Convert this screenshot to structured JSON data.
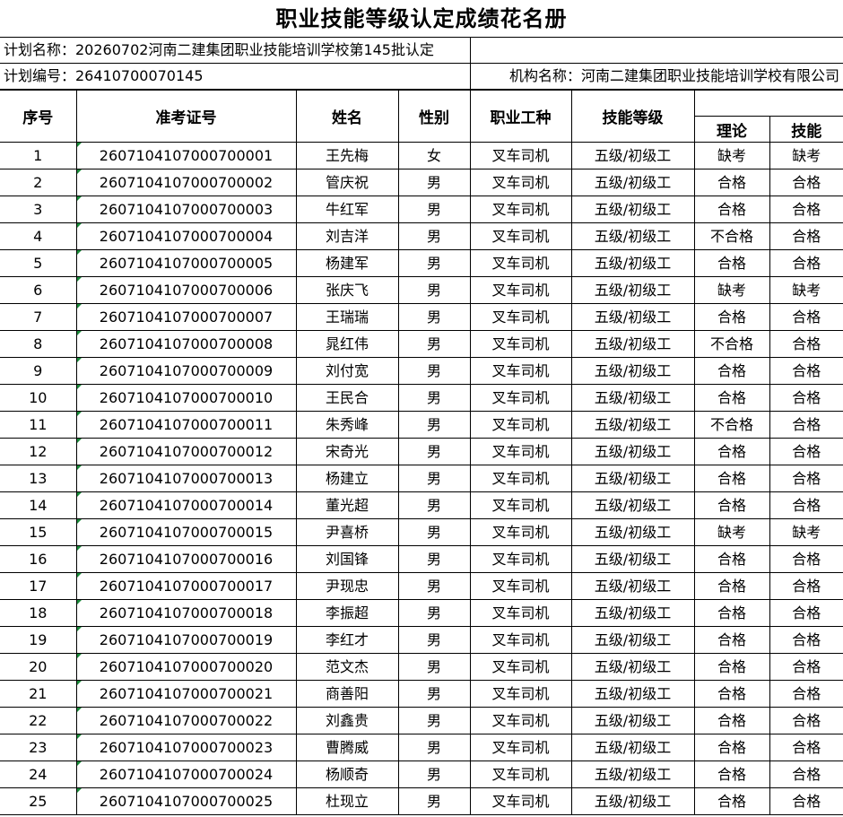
{
  "title": "职业技能等级认定成绩花名册",
  "plan_name": "计划名称：20260702河南二建集团职业技能培训学校第145批认定",
  "plan_number": "计划编号：26410700070145",
  "org_name": "机构名称：河南二建集团职业技能培训学校有限公司",
  "headers": {
    "seq": "序号",
    "exam_id": "准考证号",
    "name": "姓名",
    "gender": "性别",
    "job": "职业工种",
    "level": "技能等级",
    "theory": "理论",
    "skill": "技能"
  },
  "rows": [
    {
      "seq": "1",
      "exam_id": "2607104107000700001",
      "name": "王先梅",
      "gender": "女",
      "job": "叉车司机",
      "level": "五级/初级工",
      "theory": "缺考",
      "skill": "缺考"
    },
    {
      "seq": "2",
      "exam_id": "2607104107000700002",
      "name": "管庆祝",
      "gender": "男",
      "job": "叉车司机",
      "level": "五级/初级工",
      "theory": "合格",
      "skill": "合格"
    },
    {
      "seq": "3",
      "exam_id": "2607104107000700003",
      "name": "牛红军",
      "gender": "男",
      "job": "叉车司机",
      "level": "五级/初级工",
      "theory": "合格",
      "skill": "合格"
    },
    {
      "seq": "4",
      "exam_id": "2607104107000700004",
      "name": "刘吉洋",
      "gender": "男",
      "job": "叉车司机",
      "level": "五级/初级工",
      "theory": "不合格",
      "skill": "合格"
    },
    {
      "seq": "5",
      "exam_id": "2607104107000700005",
      "name": "杨建军",
      "gender": "男",
      "job": "叉车司机",
      "level": "五级/初级工",
      "theory": "合格",
      "skill": "合格"
    },
    {
      "seq": "6",
      "exam_id": "2607104107000700006",
      "name": "张庆飞",
      "gender": "男",
      "job": "叉车司机",
      "level": "五级/初级工",
      "theory": "缺考",
      "skill": "缺考"
    },
    {
      "seq": "7",
      "exam_id": "2607104107000700007",
      "name": "王瑞瑞",
      "gender": "男",
      "job": "叉车司机",
      "level": "五级/初级工",
      "theory": "合格",
      "skill": "合格"
    },
    {
      "seq": "8",
      "exam_id": "2607104107000700008",
      "name": "晁红伟",
      "gender": "男",
      "job": "叉车司机",
      "level": "五级/初级工",
      "theory": "不合格",
      "skill": "合格"
    },
    {
      "seq": "9",
      "exam_id": "2607104107000700009",
      "name": "刘付宽",
      "gender": "男",
      "job": "叉车司机",
      "level": "五级/初级工",
      "theory": "合格",
      "skill": "合格"
    },
    {
      "seq": "10",
      "exam_id": "2607104107000700010",
      "name": "王民合",
      "gender": "男",
      "job": "叉车司机",
      "level": "五级/初级工",
      "theory": "合格",
      "skill": "合格"
    },
    {
      "seq": "11",
      "exam_id": "2607104107000700011",
      "name": "朱秀峰",
      "gender": "男",
      "job": "叉车司机",
      "level": "五级/初级工",
      "theory": "不合格",
      "skill": "合格"
    },
    {
      "seq": "12",
      "exam_id": "2607104107000700012",
      "name": "宋奇光",
      "gender": "男",
      "job": "叉车司机",
      "level": "五级/初级工",
      "theory": "合格",
      "skill": "合格"
    },
    {
      "seq": "13",
      "exam_id": "2607104107000700013",
      "name": "杨建立",
      "gender": "男",
      "job": "叉车司机",
      "level": "五级/初级工",
      "theory": "合格",
      "skill": "合格"
    },
    {
      "seq": "14",
      "exam_id": "2607104107000700014",
      "name": "董光超",
      "gender": "男",
      "job": "叉车司机",
      "level": "五级/初级工",
      "theory": "合格",
      "skill": "合格"
    },
    {
      "seq": "15",
      "exam_id": "2607104107000700015",
      "name": "尹喜桥",
      "gender": "男",
      "job": "叉车司机",
      "level": "五级/初级工",
      "theory": "缺考",
      "skill": "缺考"
    },
    {
      "seq": "16",
      "exam_id": "2607104107000700016",
      "name": "刘国锋",
      "gender": "男",
      "job": "叉车司机",
      "level": "五级/初级工",
      "theory": "合格",
      "skill": "合格"
    },
    {
      "seq": "17",
      "exam_id": "2607104107000700017",
      "name": "尹现忠",
      "gender": "男",
      "job": "叉车司机",
      "level": "五级/初级工",
      "theory": "合格",
      "skill": "合格"
    },
    {
      "seq": "18",
      "exam_id": "2607104107000700018",
      "name": "李振超",
      "gender": "男",
      "job": "叉车司机",
      "level": "五级/初级工",
      "theory": "合格",
      "skill": "合格"
    },
    {
      "seq": "19",
      "exam_id": "2607104107000700019",
      "name": "李红才",
      "gender": "男",
      "job": "叉车司机",
      "level": "五级/初级工",
      "theory": "合格",
      "skill": "合格"
    },
    {
      "seq": "20",
      "exam_id": "2607104107000700020",
      "name": "范文杰",
      "gender": "男",
      "job": "叉车司机",
      "level": "五级/初级工",
      "theory": "合格",
      "skill": "合格"
    },
    {
      "seq": "21",
      "exam_id": "2607104107000700021",
      "name": "商善阳",
      "gender": "男",
      "job": "叉车司机",
      "level": "五级/初级工",
      "theory": "合格",
      "skill": "合格"
    },
    {
      "seq": "22",
      "exam_id": "2607104107000700022",
      "name": "刘鑫贵",
      "gender": "男",
      "job": "叉车司机",
      "level": "五级/初级工",
      "theory": "合格",
      "skill": "合格"
    },
    {
      "seq": "23",
      "exam_id": "2607104107000700023",
      "name": "曹腾威",
      "gender": "男",
      "job": "叉车司机",
      "level": "五级/初级工",
      "theory": "合格",
      "skill": "合格"
    },
    {
      "seq": "24",
      "exam_id": "2607104107000700024",
      "name": "杨顺奇",
      "gender": "男",
      "job": "叉车司机",
      "level": "五级/初级工",
      "theory": "合格",
      "skill": "合格"
    },
    {
      "seq": "25",
      "exam_id": "2607104107000700025",
      "name": "杜现立",
      "gender": "男",
      "job": "叉车司机",
      "level": "五级/初级工",
      "theory": "合格",
      "skill": "合格"
    }
  ],
  "colors": {
    "cell_marker": "#1a8a3a",
    "border": "#000000"
  }
}
